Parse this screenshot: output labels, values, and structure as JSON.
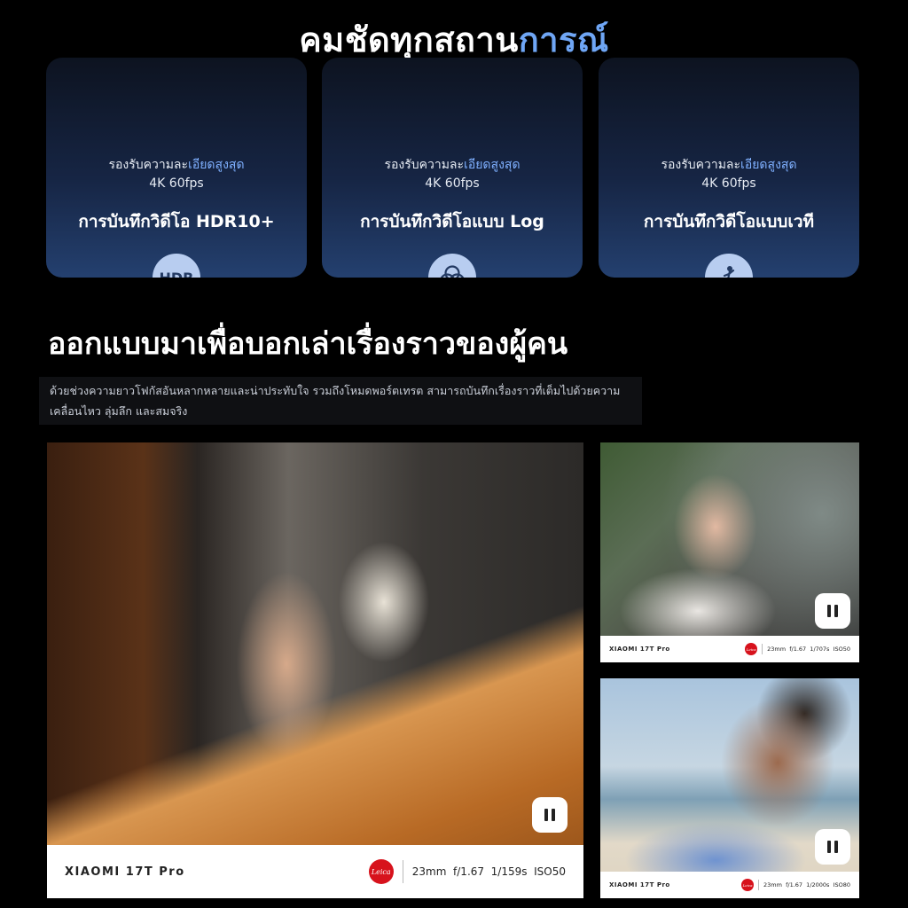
{
  "header": {
    "title_part1": "คมชัดทุกสถาน",
    "title_part2": "การณ์"
  },
  "cards": [
    {
      "sub_prefix": "รองรับความละ",
      "sub_highlight": "เอียดสูงสุด",
      "fps": "4K 60fps",
      "name": "การบันทึกวิดีโอ HDR10+",
      "icon": "hdr-icon",
      "icon_text": "HDR"
    },
    {
      "sub_prefix": "รองรับความละ",
      "sub_highlight": "เอียดสูงสุด",
      "fps": "4K 60fps",
      "name": "การบันทึกวิดีโอแบบ Log",
      "icon": "color-circles-icon"
    },
    {
      "sub_prefix": "รองรับความละ",
      "sub_highlight": "เอียดสูงสุด",
      "fps": "4K 60fps",
      "name": "การบันทึกวิดีโอแบบเวที",
      "icon": "stage-performer-icon"
    }
  ],
  "section": {
    "title": "ออกแบบมาเพื่อบอกเล่าเรื่องราวของผู้คน",
    "desc_line1": "ด้วยช่วงความยาวโฟกัสอันหลากหลายและน่าประทับใจ รวมถึงโหมดพอร์ตเทรต สามารถบันทึกเรื่องราวที่เต็มไปด้วยความ",
    "desc_line2": "เคลื่อนไหว ลุ่มลึก และสมจริง"
  },
  "photos": [
    {
      "brand": "XIAOMI 17T Pro",
      "leica": "Leica",
      "specs": "23mm  f/1.67  1/159s  ISO50"
    },
    {
      "brand": "XIAOMI 17T Pro",
      "leica": "Leica",
      "specs": "23mm  f/1.67  1/707s  ISO50"
    },
    {
      "brand": "XIAOMI 17T Pro",
      "leica": "Leica",
      "specs": "23mm  f/1.67  1/2000s  ISO80"
    }
  ],
  "colors": {
    "accent": "#6fa6f5",
    "card_top": "#0d1320",
    "card_bottom": "#24406f",
    "leica_red": "#d7121c"
  }
}
